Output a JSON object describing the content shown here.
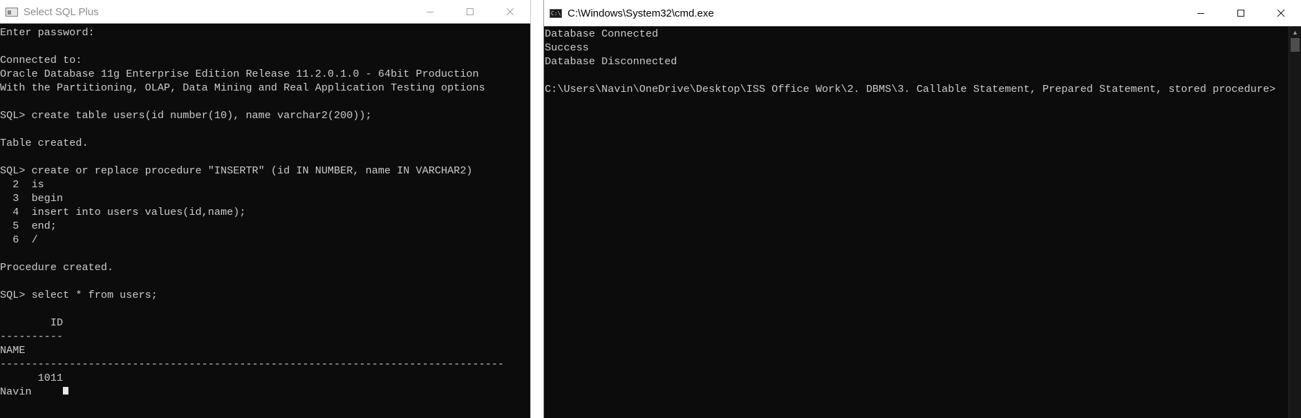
{
  "sqlplus": {
    "title": "Select SQL Plus",
    "lines": [
      "Enter password:",
      "",
      "Connected to:",
      "Oracle Database 11g Enterprise Edition Release 11.2.0.1.0 - 64bit Production",
      "With the Partitioning, OLAP, Data Mining and Real Application Testing options",
      "",
      "SQL> create table users(id number(10), name varchar2(200));",
      "",
      "Table created.",
      "",
      "SQL> create or replace procedure \"INSERTR\" (id IN NUMBER, name IN VARCHAR2)",
      "  2  is",
      "  3  begin",
      "  4  insert into users values(id,name);",
      "  5  end;",
      "  6  /",
      "",
      "Procedure created.",
      "",
      "SQL> select * from users;",
      "",
      "        ID",
      "----------",
      "NAME",
      "--------------------------------------------------------------------------------",
      "      1011",
      "Navin"
    ]
  },
  "cmd": {
    "title": "C:\\Windows\\System32\\cmd.exe",
    "icon_text": "C:\\",
    "lines": [
      "Database Connected",
      "Success",
      "Database Disconnected",
      "",
      "C:\\Users\\Navin\\OneDrive\\Desktop\\ISS Office Work\\2. DBMS\\3. Callable Statement, Prepared Statement, stored procedure>"
    ]
  },
  "icons": {
    "minimize": "minimize-icon",
    "maximize": "maximize-icon",
    "close": "close-icon"
  },
  "colors": {
    "console_bg": "#0c0c0c",
    "console_text": "#cccccc",
    "inactive_title": "#8c8c8c"
  }
}
